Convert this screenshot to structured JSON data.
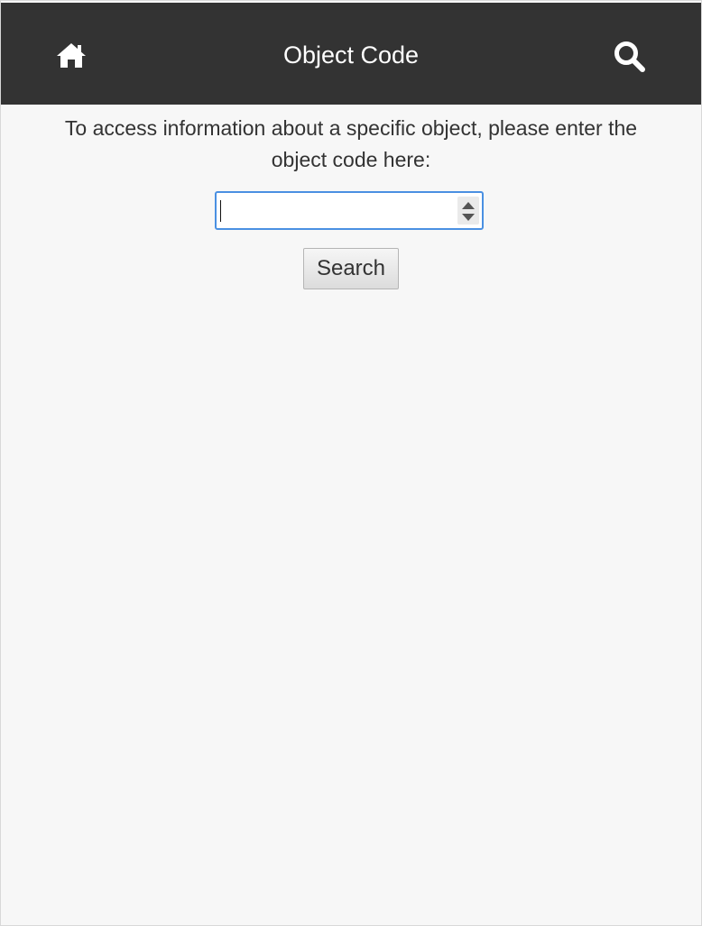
{
  "header": {
    "title": "Object Code",
    "left_icon": "home-icon",
    "right_icon": "search-icon",
    "background": "#333333",
    "text_color": "#ffffff"
  },
  "main": {
    "instructions": "To access information about a specific object, please enter the object code here:",
    "code_input": {
      "value": "",
      "placeholder": ""
    },
    "search_label": "Search",
    "spinner_up_icon": "chevron-up-icon",
    "spinner_down_icon": "chevron-down-icon",
    "focus_color": "#4a90e2"
  },
  "page": {
    "background": "#f7f7f7"
  }
}
